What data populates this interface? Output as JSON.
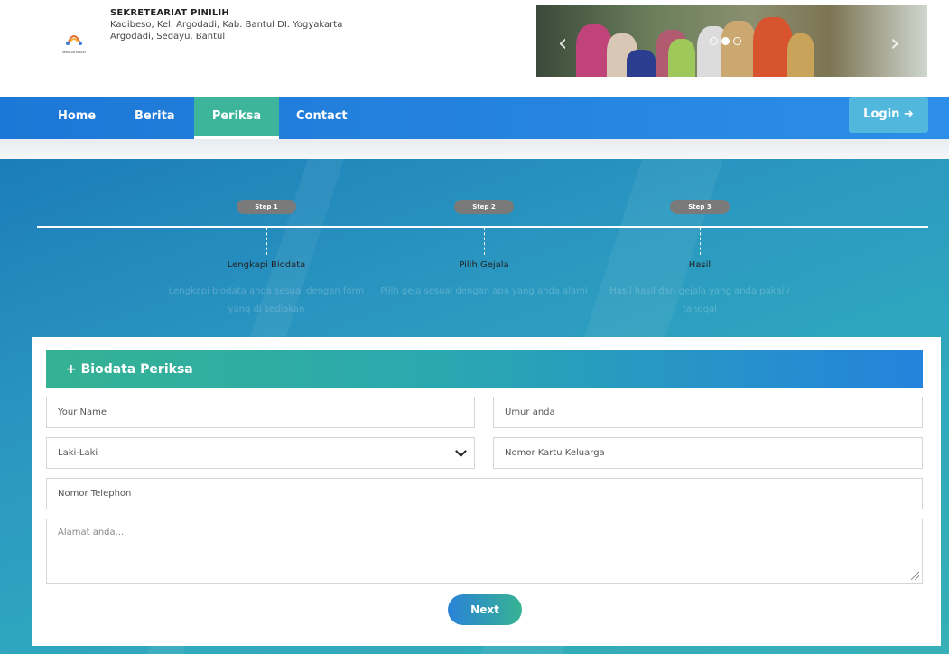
{
  "header": {
    "org_name": "SEKRETEARIAT PINILIH",
    "address_line1": "Kadibeso, Kel. Argodadi, Kab. Bantul DI. Yogyakarta",
    "address_line2": "Argodadi, Sedayu, Bantul",
    "logo_caption": "SEKOLAH PINILIH"
  },
  "banner": {
    "prev_arrow": "‹",
    "next_arrow": "›",
    "slide_count": 3,
    "active_slide": 2
  },
  "nav": {
    "items": [
      {
        "label": "Home",
        "active": false
      },
      {
        "label": "Berita",
        "active": false
      },
      {
        "label": "Periksa",
        "active": true
      },
      {
        "label": "Contact",
        "active": false
      }
    ],
    "login_label": "Login ➜"
  },
  "steps": [
    {
      "badge": "Step 1",
      "title": "Lengkapi Biodata",
      "desc": "Lengkapi biodata anda sesuai dengan form yang di sediakan"
    },
    {
      "badge": "Step 2",
      "title": "Pilih Gejala",
      "desc": "Pilih geja sesuai dengan apa yang anda alami"
    },
    {
      "badge": "Step 3",
      "title": "Hasil",
      "desc": "Hasil hasil dari gejala yang anda pakai / tanggal"
    }
  ],
  "form": {
    "title": "+ Biodata Periksa",
    "name_placeholder": "Your Name",
    "age_placeholder": "Umur anda",
    "gender_value": "Laki-Laki",
    "kk_placeholder": "Nomor Kartu Keluarga",
    "phone_placeholder": "Nomor Telephon",
    "address_placeholder": "Alamat anda...",
    "next_label": "Next"
  },
  "colors": {
    "nav_blue": "#1d77d6",
    "active_green": "#3cb59a",
    "login_bg": "#52b7dd",
    "hero_blue": "#2a97c0"
  }
}
